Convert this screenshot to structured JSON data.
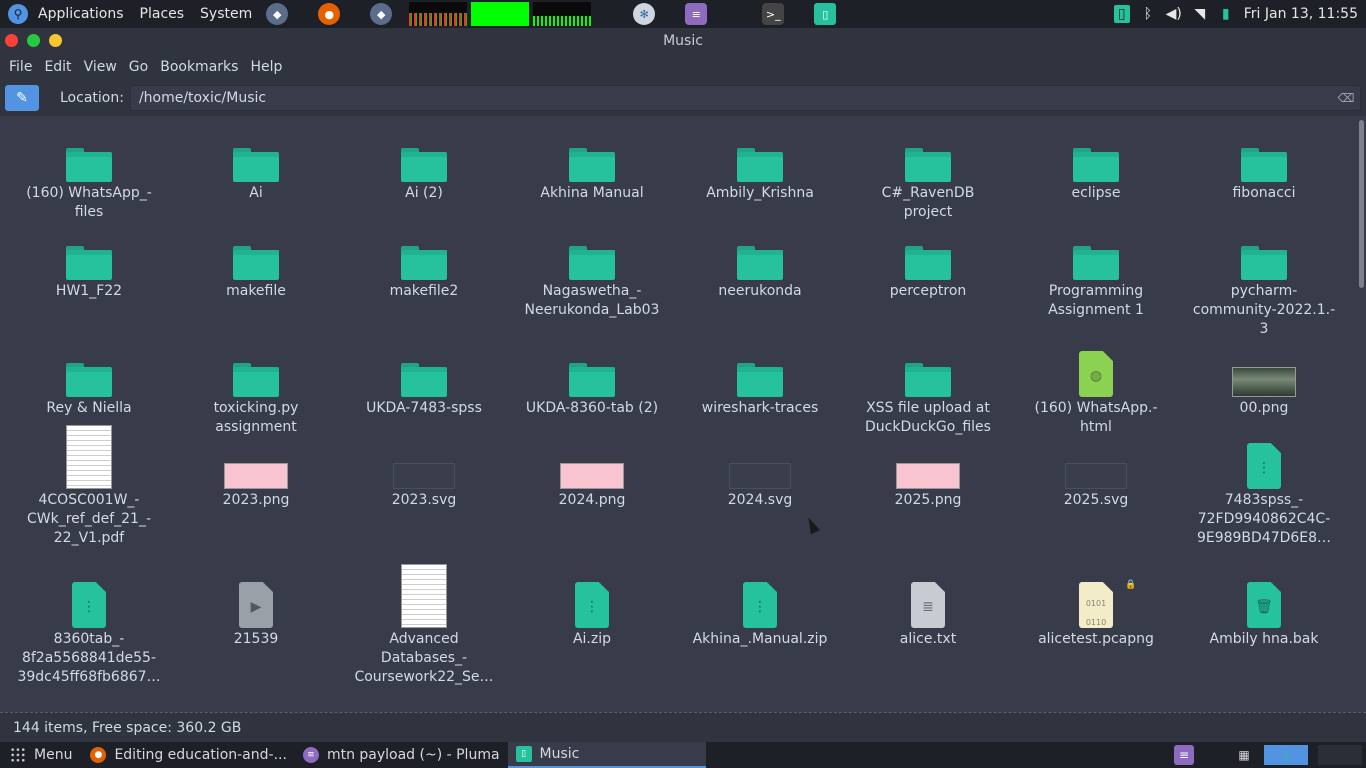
{
  "top_panel": {
    "menus": [
      "Applications",
      "Places",
      "System"
    ],
    "clock": "Fri Jan 13, 11:55"
  },
  "window": {
    "title": "Music"
  },
  "menubar": [
    "File",
    "Edit",
    "View",
    "Go",
    "Bookmarks",
    "Help"
  ],
  "location": {
    "label": "Location:",
    "path": "/home/toxic/Music"
  },
  "items": [
    {
      "name": "(160) WhatsApp_-\nfiles",
      "kind": "folder"
    },
    {
      "name": "Ai",
      "kind": "folder"
    },
    {
      "name": "Ai (2)",
      "kind": "folder"
    },
    {
      "name": "Akhina Manual",
      "kind": "folder"
    },
    {
      "name": "Ambily_Krishna",
      "kind": "folder"
    },
    {
      "name": "C#_RavenDB\nproject",
      "kind": "folder"
    },
    {
      "name": "eclipse",
      "kind": "folder"
    },
    {
      "name": "fibonacci",
      "kind": "folder"
    },
    {
      "name": "HW1_F22",
      "kind": "folder"
    },
    {
      "name": "makefile",
      "kind": "folder"
    },
    {
      "name": "makefile2",
      "kind": "folder"
    },
    {
      "name": "Nagaswetha_-\nNeerukonda_Lab03",
      "kind": "folder"
    },
    {
      "name": "neerukonda",
      "kind": "folder"
    },
    {
      "name": "perceptron",
      "kind": "folder"
    },
    {
      "name": "Programming\nAssignment 1",
      "kind": "folder"
    },
    {
      "name": "pycharm-\ncommunity-2022.1.-\n3",
      "kind": "folder"
    },
    {
      "name": "Rey & Niella",
      "kind": "folder"
    },
    {
      "name": "toxicking.py\nassignment",
      "kind": "folder"
    },
    {
      "name": "UKDA-7483-spss",
      "kind": "folder"
    },
    {
      "name": "UKDA-8360-tab (2)",
      "kind": "folder"
    },
    {
      "name": "wireshark-traces",
      "kind": "folder"
    },
    {
      "name": "XSS file upload at\nDuckDuckGo_files",
      "kind": "folder"
    },
    {
      "name": "(160) WhatsApp.-\nhtml",
      "kind": "html"
    },
    {
      "name": "00.png",
      "kind": "photo"
    },
    {
      "name": "4COSC001W_-\nCWk_ref_def_21_-\n22_V1.pdf",
      "kind": "pdf"
    },
    {
      "name": "2023.png",
      "kind": "png-pink"
    },
    {
      "name": "2023.svg",
      "kind": "svg"
    },
    {
      "name": "2024.png",
      "kind": "png-pink"
    },
    {
      "name": "2024.svg",
      "kind": "svg"
    },
    {
      "name": "2025.png",
      "kind": "png-pink"
    },
    {
      "name": "2025.svg",
      "kind": "svg"
    },
    {
      "name": "7483spss_-\n72FD9940862C4C-\n9E989BD47D6E8…",
      "kind": "archive"
    },
    {
      "name": "8360tab_-\n8f2a5568841de55-\n39dc45ff68fb6867…",
      "kind": "archive"
    },
    {
      "name": "21539",
      "kind": "video"
    },
    {
      "name": "Advanced\nDatabases_-\nCoursework22_Se…",
      "kind": "pdf"
    },
    {
      "name": "Ai.zip",
      "kind": "archive"
    },
    {
      "name": "Akhina_.Manual.zip",
      "kind": "archive"
    },
    {
      "name": "alice.txt",
      "kind": "text"
    },
    {
      "name": "alicetest.pcapng",
      "kind": "binary"
    },
    {
      "name": "Ambily hna.bak",
      "kind": "trash"
    }
  ],
  "status": "144 items, Free space: 360.2 GB",
  "taskbar": {
    "menu_label": "Menu",
    "tasks": [
      "Editing education-and-...",
      "mtn payload (~) - Pluma",
      "Music"
    ]
  },
  "colors": {
    "accent": "#5294e2",
    "folder": "#26c19d",
    "close": "#fc4138",
    "minimize": "#28c940",
    "maximize": "#f6c630"
  }
}
